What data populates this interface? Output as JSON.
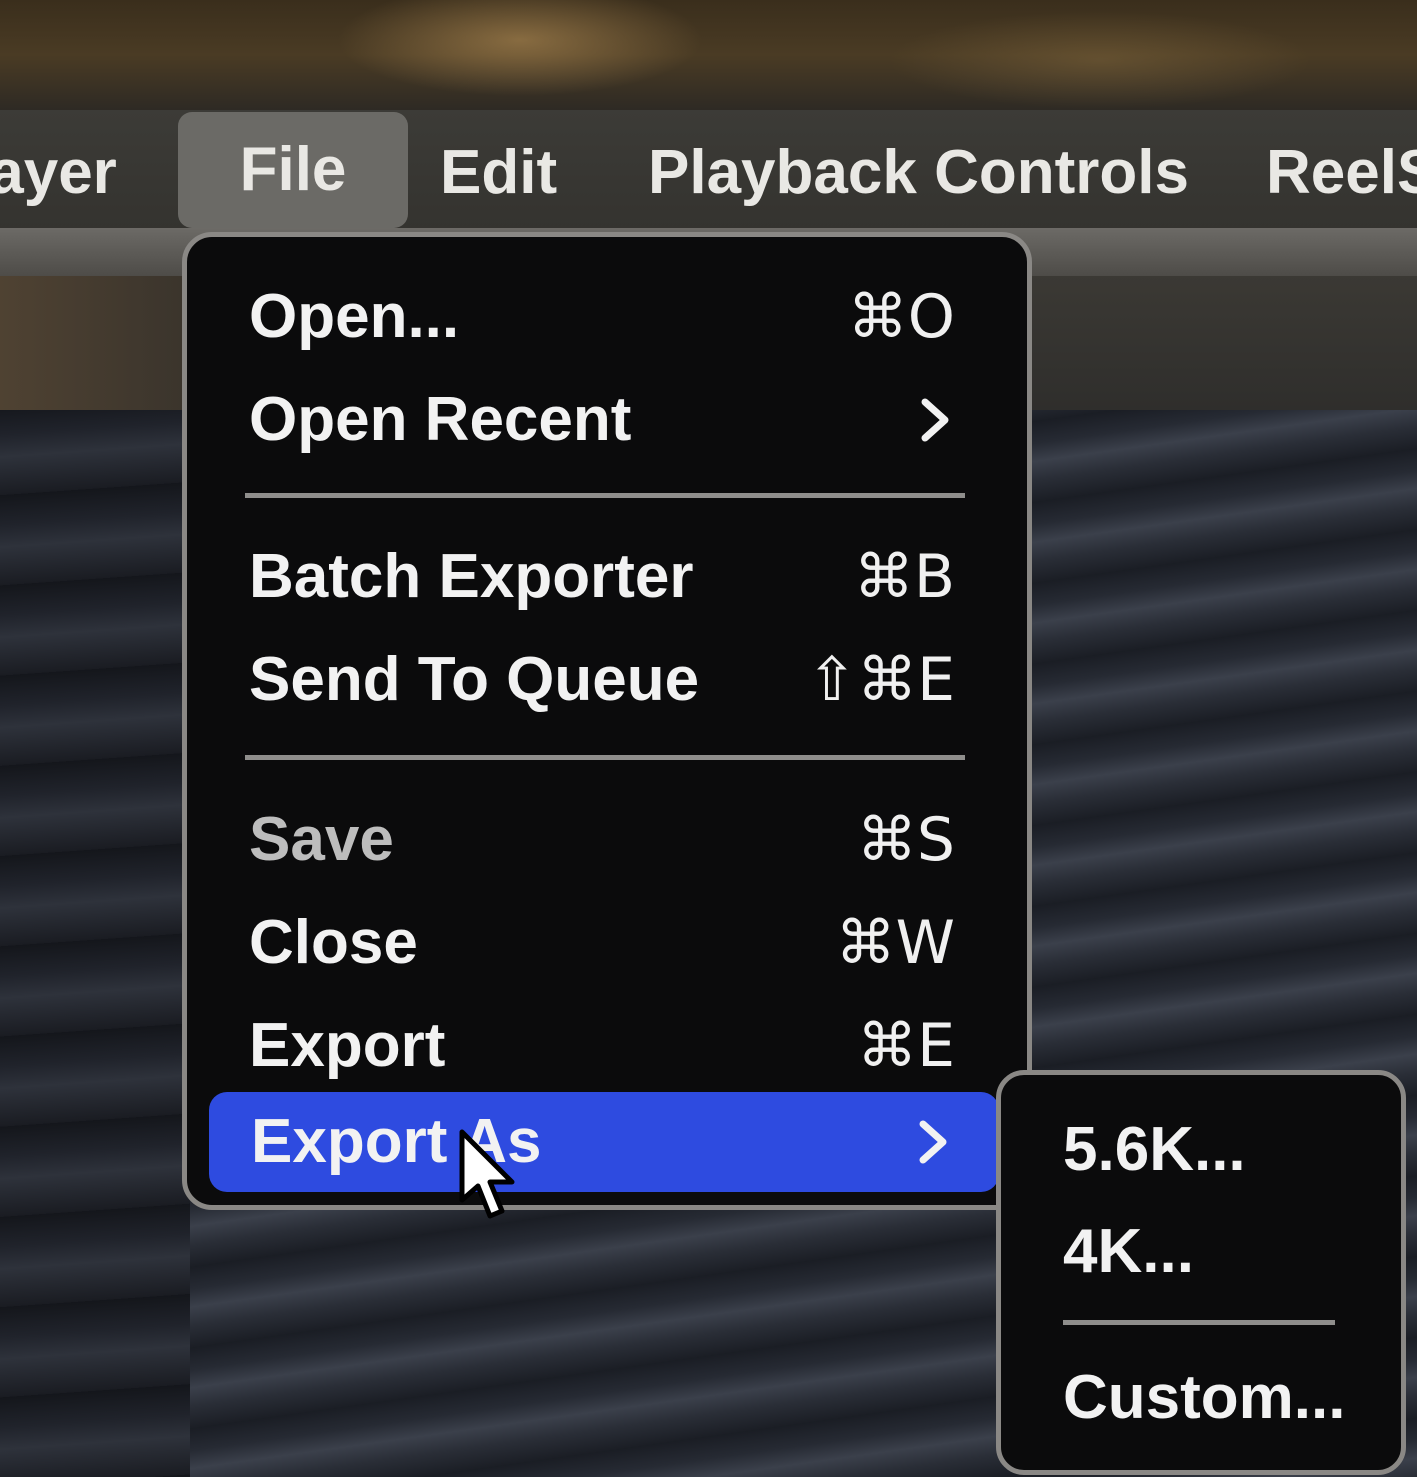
{
  "menubar": {
    "items": [
      {
        "label": "layer"
      },
      {
        "label": "File"
      },
      {
        "label": "Edit"
      },
      {
        "label": "Playback Controls"
      },
      {
        "label": "ReelS"
      }
    ],
    "active": "File"
  },
  "file_menu": {
    "items": [
      {
        "label": "Open...",
        "shortcut": "⌘O"
      },
      {
        "label": "Open Recent",
        "shortcut": "",
        "submenu": true,
        "icon": "chevron-right-icon"
      },
      {
        "label": "Batch Exporter",
        "shortcut": "⌘B"
      },
      {
        "label": "Send To Queue",
        "shortcut": "⇧⌘E"
      },
      {
        "label": "Save",
        "shortcut": "⌘S",
        "disabled": true
      },
      {
        "label": "Close",
        "shortcut": "⌘W"
      },
      {
        "label": "Export",
        "shortcut": "⌘E"
      },
      {
        "label": "Export As",
        "shortcut": "",
        "submenu": true,
        "highlighted": true,
        "icon": "chevron-right-icon"
      }
    ]
  },
  "export_as_submenu": {
    "items": [
      {
        "label": "5.6K..."
      },
      {
        "label": "4K..."
      },
      {
        "label": "Custom..."
      }
    ]
  },
  "colors": {
    "highlight": "#2e4be0",
    "menu_bg": "#0b0b0c",
    "menubar_bg": "#3c3b37",
    "text": "#f2f2f2"
  },
  "cursor": {
    "icon": "arrow-pointer-icon"
  }
}
